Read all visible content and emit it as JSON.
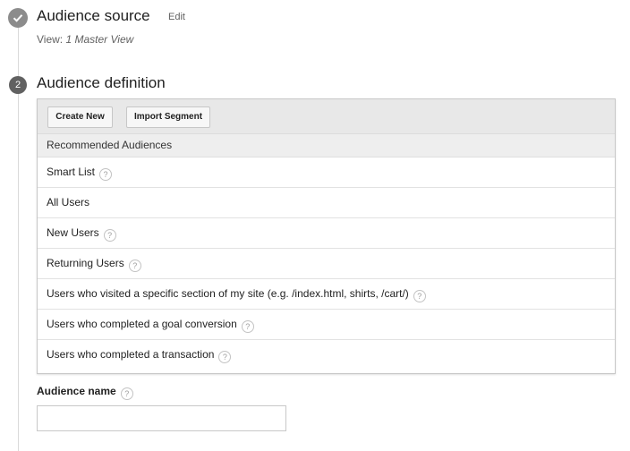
{
  "colors": {
    "rail": "#dadada",
    "step_complete": "#8c8c8c",
    "step_active": "#616161"
  },
  "step1": {
    "icon": "check-icon",
    "title": "Audience source",
    "edit": "Edit",
    "view_prefix": "View: ",
    "view_name": "1 Master View"
  },
  "step2": {
    "number": "2",
    "title": "Audience definition",
    "toolbar": {
      "create_new": "Create New",
      "import_segment": "Import Segment"
    },
    "section_header": "Recommended Audiences",
    "items": [
      {
        "label": "Smart List",
        "help": "?"
      },
      {
        "label": "All Users"
      },
      {
        "label": "New Users",
        "help": "?"
      },
      {
        "label": "Returning Users",
        "help": "?"
      },
      {
        "label": "Users who visited a specific section of my site (e.g. /index.html, shirts, /cart/)",
        "help": "?"
      },
      {
        "label": "Users who completed a goal conversion",
        "help": "?"
      },
      {
        "label": "Users who completed a transaction",
        "help": "?"
      }
    ],
    "audience_name": {
      "label": "Audience name",
      "help": "?",
      "value": "",
      "placeholder": ""
    }
  }
}
